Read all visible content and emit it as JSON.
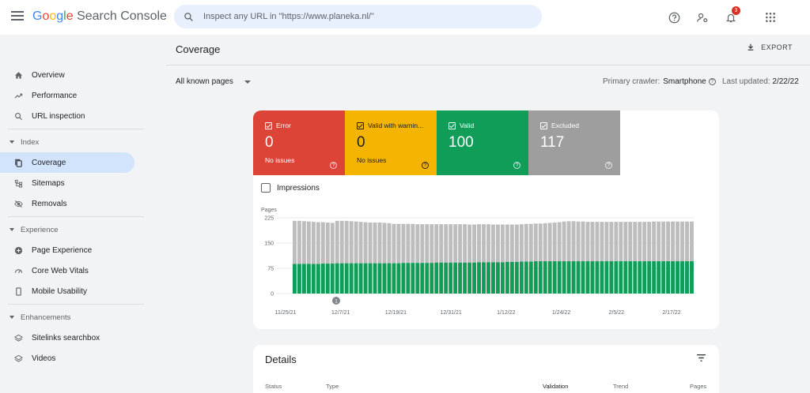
{
  "app": {
    "title": "Google Search Console",
    "title_parts": [
      "G",
      "o",
      "o",
      "g",
      "l",
      "e",
      " Search Console"
    ]
  },
  "search": {
    "placeholder": "Inspect any URL in \"https://www.planeka.nl/\""
  },
  "notifications": {
    "count": "3"
  },
  "sidebar": {
    "items_top": [
      {
        "label": "Overview",
        "icon": "home-icon"
      },
      {
        "label": "Performance",
        "icon": "trending-icon"
      },
      {
        "label": "URL inspection",
        "icon": "search-icon"
      }
    ],
    "sections": [
      {
        "label": "Index",
        "items": [
          {
            "label": "Coverage",
            "icon": "coverage-icon",
            "active": true
          },
          {
            "label": "Sitemaps",
            "icon": "sitemap-icon"
          },
          {
            "label": "Removals",
            "icon": "eye-off-icon"
          }
        ]
      },
      {
        "label": "Experience",
        "items": [
          {
            "label": "Page Experience",
            "icon": "plus-circle-icon"
          },
          {
            "label": "Core Web Vitals",
            "icon": "gauge-icon"
          },
          {
            "label": "Mobile Usability",
            "icon": "phone-icon"
          }
        ]
      },
      {
        "label": "Enhancements",
        "items": [
          {
            "label": "Sitelinks searchbox",
            "icon": "layers-icon"
          },
          {
            "label": "Videos",
            "icon": "layers-icon"
          }
        ]
      }
    ]
  },
  "header": {
    "title": "Coverage",
    "export_label": "EXPORT",
    "pages_filter": "All known pages",
    "crawler_label": "Primary crawler:",
    "crawler_value": "Smartphone",
    "updated_label": "Last updated:",
    "updated_value": "2/22/22"
  },
  "tiles": {
    "error": {
      "label": "Error",
      "value": "0",
      "sub": "No issues"
    },
    "warning": {
      "label": "Valid with warnin...",
      "value": "0",
      "sub": "No issues"
    },
    "valid": {
      "label": "Valid",
      "value": "100"
    },
    "excluded": {
      "label": "Excluded",
      "value": "117"
    }
  },
  "impressions_label": "Impressions",
  "colors": {
    "valid": "#0f9d58",
    "excluded": "#bdbdbd",
    "error": "#db4437",
    "warning": "#f4b400"
  },
  "chart_data": {
    "type": "bar",
    "stacked": true,
    "ylabel": "Pages",
    "yticks": [
      "225",
      "150",
      "75",
      "0"
    ],
    "ylim": [
      0,
      225
    ],
    "xticks": [
      "11/25/21",
      "12/7/21",
      "12/19/21",
      "12/31/21",
      "1/12/22",
      "1/24/22",
      "2/5/22",
      "2/17/22"
    ],
    "annotation": "1",
    "series": [
      {
        "name": "Valid",
        "values": [
          88,
          88,
          88,
          88,
          88,
          88,
          89,
          89,
          89,
          90,
          90,
          90,
          90,
          90,
          90,
          90,
          90,
          90,
          90,
          90,
          90,
          90,
          90,
          91,
          91,
          91,
          91,
          91,
          91,
          91,
          92,
          92,
          92,
          92,
          92,
          92,
          92,
          92,
          92,
          93,
          93,
          93,
          93,
          93,
          93,
          94,
          94,
          94,
          95,
          95,
          95,
          96,
          96,
          96,
          96,
          96,
          96,
          96,
          96,
          96,
          96,
          96,
          96,
          96,
          96,
          96,
          96,
          96,
          96,
          96,
          96,
          96,
          96,
          96,
          96,
          96,
          96,
          96,
          96,
          96,
          96,
          96,
          96,
          96,
          96
        ]
      },
      {
        "name": "Excluded",
        "values": [
          128,
          128,
          127,
          126,
          125,
          124,
          123,
          122,
          121,
          126,
          126,
          126,
          125,
          124,
          123,
          122,
          121,
          121,
          121,
          120,
          119,
          117,
          117,
          116,
          116,
          116,
          115,
          115,
          115,
          115,
          114,
          114,
          114,
          114,
          114,
          114,
          114,
          113,
          113,
          113,
          113,
          113,
          112,
          112,
          112,
          111,
          111,
          111,
          111,
          112,
          112,
          112,
          112,
          113,
          114,
          115,
          116,
          118,
          119,
          119,
          118,
          118,
          117,
          117,
          117,
          117,
          117,
          117,
          117,
          117,
          117,
          117,
          117,
          117,
          117,
          117,
          118,
          118,
          118,
          118,
          118,
          118,
          118,
          118,
          118
        ]
      }
    ]
  },
  "details": {
    "title": "Details",
    "columns": [
      "Status",
      "Type",
      "Validation",
      "Trend",
      "Pages"
    ]
  }
}
